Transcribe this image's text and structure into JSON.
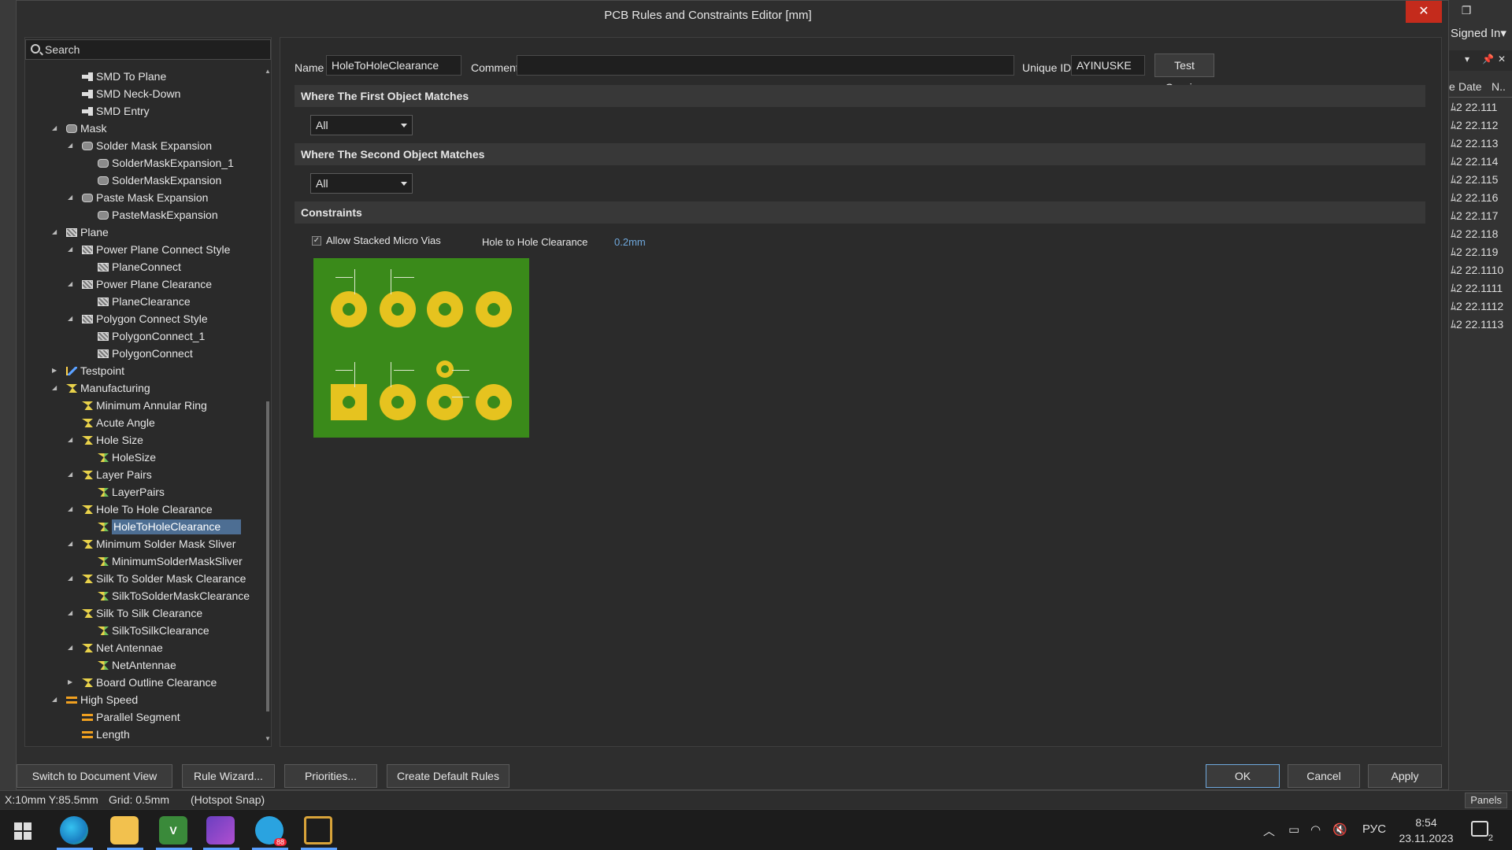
{
  "dialog": {
    "title": "PCB Rules and Constraints Editor [mm]",
    "close_glyph": "✕"
  },
  "background_app": {
    "signed_in": "Signed In▾",
    "column_date": "Date",
    "column_n": "N..",
    "column_e": "e",
    "row_prefix": "ﾑ2",
    "rows": [
      "22.111",
      "22.112",
      "22.113",
      "22.114",
      "22.115",
      "22.116",
      "22.117",
      "22.118",
      "22.119",
      "22.1110",
      "22.1111",
      "22.1112",
      "22.1113"
    ],
    "panels_label": "Panels"
  },
  "search": {
    "placeholder": "Search"
  },
  "tree": [
    {
      "label": "SMD To Plane",
      "level": 2,
      "icon": "smd-icon",
      "twisty": ""
    },
    {
      "label": "SMD Neck-Down",
      "level": 2,
      "icon": "smd-icon",
      "twisty": ""
    },
    {
      "label": "SMD Entry",
      "level": 2,
      "icon": "smd-icon",
      "twisty": ""
    },
    {
      "label": "Mask",
      "level": 1,
      "icon": "mask-icon",
      "twisty": "◢"
    },
    {
      "label": "Solder Mask Expansion",
      "level": 2,
      "icon": "mask-icon",
      "twisty": "◢"
    },
    {
      "label": "SolderMaskExpansion_1",
      "level": 3,
      "icon": "mask-icon",
      "twisty": ""
    },
    {
      "label": "SolderMaskExpansion",
      "level": 3,
      "icon": "mask-icon",
      "twisty": ""
    },
    {
      "label": "Paste Mask Expansion",
      "level": 2,
      "icon": "mask-icon",
      "twisty": "◢"
    },
    {
      "label": "PasteMaskExpansion",
      "level": 3,
      "icon": "mask-icon",
      "twisty": ""
    },
    {
      "label": "Plane",
      "level": 1,
      "icon": "plane-icon",
      "twisty": "◢"
    },
    {
      "label": "Power Plane Connect Style",
      "level": 2,
      "icon": "plane-icon",
      "twisty": "◢"
    },
    {
      "label": "PlaneConnect",
      "level": 3,
      "icon": "plane-icon",
      "twisty": ""
    },
    {
      "label": "Power Plane Clearance",
      "level": 2,
      "icon": "plane-icon",
      "twisty": "◢"
    },
    {
      "label": "PlaneClearance",
      "level": 3,
      "icon": "plane-icon",
      "twisty": ""
    },
    {
      "label": "Polygon Connect Style",
      "level": 2,
      "icon": "plane-icon",
      "twisty": "◢"
    },
    {
      "label": "PolygonConnect_1",
      "level": 3,
      "icon": "plane-icon",
      "twisty": ""
    },
    {
      "label": "PolygonConnect",
      "level": 3,
      "icon": "plane-icon",
      "twisty": ""
    },
    {
      "label": "Testpoint",
      "level": 1,
      "icon": "testpoint-icon",
      "twisty": "▶"
    },
    {
      "label": "Manufacturing",
      "level": 1,
      "icon": "manufacturing-icon",
      "twisty": "◢"
    },
    {
      "label": "Minimum Annular Ring",
      "level": 2,
      "icon": "manufacturing-icon",
      "twisty": ""
    },
    {
      "label": "Acute Angle",
      "level": 2,
      "icon": "manufacturing-icon",
      "twisty": ""
    },
    {
      "label": "Hole Size",
      "level": 2,
      "icon": "manufacturing-icon",
      "twisty": "◢"
    },
    {
      "label": "HoleSize",
      "level": 3,
      "icon": "manufacturing-icon",
      "twisty": ""
    },
    {
      "label": "Layer Pairs",
      "level": 2,
      "icon": "manufacturing-icon",
      "twisty": "◢"
    },
    {
      "label": "LayerPairs",
      "level": 3,
      "icon": "manufacturing-icon",
      "twisty": ""
    },
    {
      "label": "Hole To Hole Clearance",
      "level": 2,
      "icon": "manufacturing-icon",
      "twisty": "◢"
    },
    {
      "label": "HoleToHoleClearance",
      "level": 3,
      "icon": "manufacturing-icon",
      "twisty": "",
      "selected": true
    },
    {
      "label": "Minimum Solder Mask Sliver",
      "level": 2,
      "icon": "manufacturing-icon",
      "twisty": "◢"
    },
    {
      "label": "MinimumSolderMaskSliver",
      "level": 3,
      "icon": "manufacturing-icon",
      "twisty": ""
    },
    {
      "label": "Silk To Solder Mask Clearance",
      "level": 2,
      "icon": "manufacturing-icon",
      "twisty": "◢"
    },
    {
      "label": "SilkToSolderMaskClearance",
      "level": 3,
      "icon": "manufacturing-icon",
      "twisty": ""
    },
    {
      "label": "Silk To Silk Clearance",
      "level": 2,
      "icon": "manufacturing-icon",
      "twisty": "◢"
    },
    {
      "label": "SilkToSilkClearance",
      "level": 3,
      "icon": "manufacturing-icon",
      "twisty": ""
    },
    {
      "label": "Net Antennae",
      "level": 2,
      "icon": "manufacturing-icon",
      "twisty": "◢"
    },
    {
      "label": "NetAntennae",
      "level": 3,
      "icon": "manufacturing-icon",
      "twisty": ""
    },
    {
      "label": "Board Outline Clearance",
      "level": 2,
      "icon": "manufacturing-icon",
      "twisty": "▶"
    },
    {
      "label": "High Speed",
      "level": 1,
      "icon": "high-speed-icon",
      "twisty": "◢"
    },
    {
      "label": "Parallel Segment",
      "level": 2,
      "icon": "high-speed-icon",
      "twisty": ""
    },
    {
      "label": "Length",
      "level": 2,
      "icon": "high-speed-icon",
      "twisty": ""
    }
  ],
  "rule": {
    "name_label": "Name",
    "name_value": "HoleToHoleClearance",
    "comment_label": "Comment",
    "comment_value": "",
    "uid_label": "Unique ID",
    "uid_value": "AYINUSKE",
    "test_queries": "Test Queries",
    "first_match_title": "Where The First Object Matches",
    "first_match_value": "All",
    "second_match_title": "Where The Second Object Matches",
    "second_match_value": "All",
    "constraints_title": "Constraints",
    "allow_stacked_label": "Allow Stacked Micro Vias",
    "allow_stacked_checked": true,
    "clearance_label": "Hole to Hole Clearance",
    "clearance_value": "0.2mm"
  },
  "footer": {
    "switch_view": "Switch to Document View",
    "rule_wizard": "Rule Wizard...",
    "priorities": "Priorities...",
    "create_default": "Create Default Rules",
    "ok": "OK",
    "cancel": "Cancel",
    "apply": "Apply"
  },
  "status": {
    "coords": "X:10mm Y:85.5mm",
    "grid": "Grid: 0.5mm",
    "snap": "(Hotspot Snap)"
  },
  "taskbar": {
    "telegram_badge": "88",
    "lang": "РУС",
    "time": "8:54",
    "date": "23.11.2023",
    "notif_count": "2"
  },
  "colors": {
    "accent_select": "#4d6e93",
    "close_red": "#c42b1c",
    "pcb_green": "#3a8a1a",
    "pad_yellow": "#e6c31f",
    "value_blue": "#6fa8dc"
  }
}
